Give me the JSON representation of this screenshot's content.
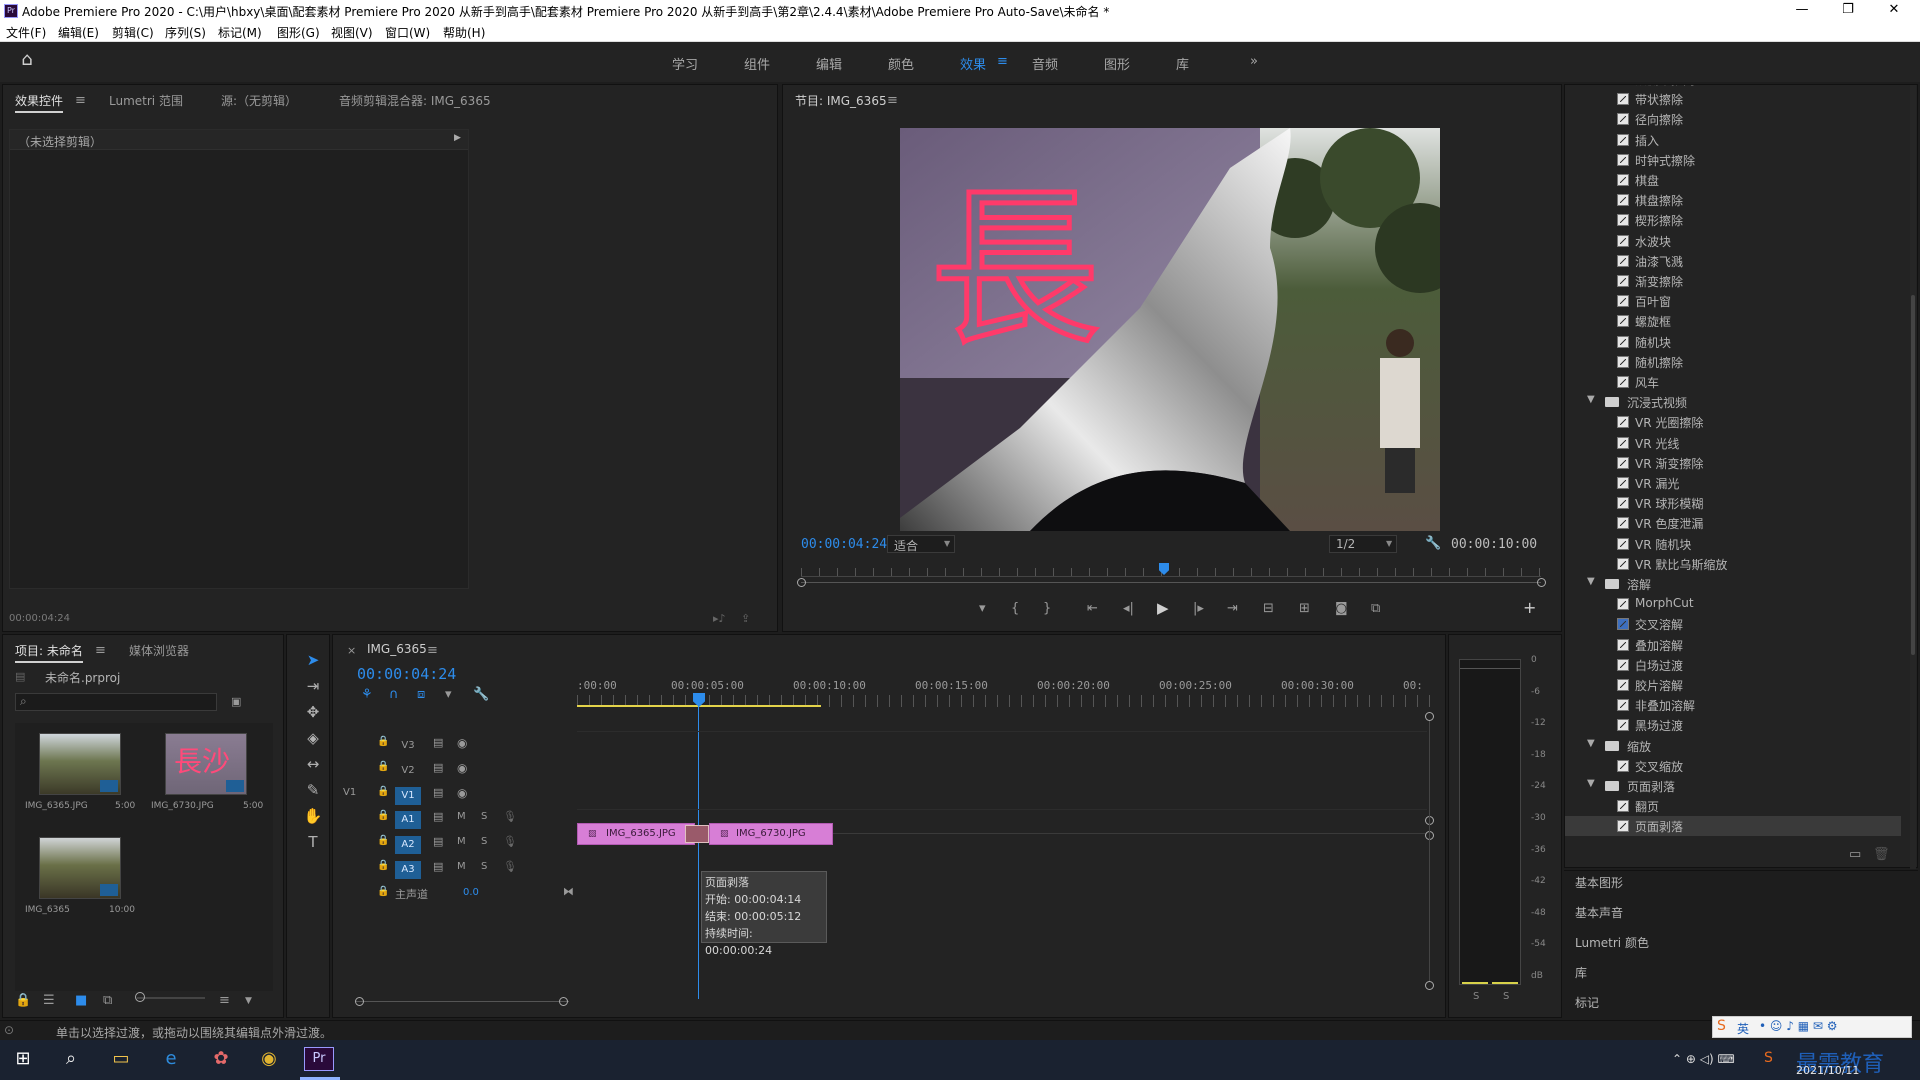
{
  "window": {
    "title": "Adobe Premiere Pro 2020 - C:\\用户\\hbxy\\桌面\\配套素材 Premiere Pro 2020 从新手到高手\\配套素材 Premiere Pro 2020 从新手到高手\\第2章\\2.4.4\\素材\\Adobe Premiere Pro Auto-Save\\未命名 *",
    "app_icon": "Pr",
    "minimize": "—",
    "restore": "❐",
    "close": "✕"
  },
  "menu": [
    "文件(F)",
    "编辑(E)",
    "剪辑(C)",
    "序列(S)",
    "标记(M)",
    "图形(G)",
    "视图(V)",
    "窗口(W)",
    "帮助(H)"
  ],
  "workspaces": {
    "tabs": [
      "学习",
      "组件",
      "编辑",
      "颜色",
      "效果",
      "音频",
      "图形",
      "库"
    ],
    "active": "效果",
    "more": "»"
  },
  "effect_controls": {
    "tabs": [
      "效果控件",
      "Lumetri 范围",
      "源:（无剪辑）",
      "音频剪辑混合器: IMG_6365"
    ],
    "no_clip": "（未选择剪辑）",
    "timecode": "00:00:04:24"
  },
  "program_monitor": {
    "title": "节目: IMG_6365",
    "current_time": "00:00:04:24",
    "fit": "适合",
    "resolution": "1/2",
    "duration": "00:00:10:00",
    "neon_text": "長"
  },
  "effects_tree": [
    {
      "type": "item",
      "label": "双侧平推门"
    },
    {
      "type": "item",
      "label": "带状擦除"
    },
    {
      "type": "item",
      "label": "径向擦除"
    },
    {
      "type": "item",
      "label": "插入"
    },
    {
      "type": "item",
      "label": "时钟式擦除"
    },
    {
      "type": "item",
      "label": "棋盘"
    },
    {
      "type": "item",
      "label": "棋盘擦除"
    },
    {
      "type": "item",
      "label": "楔形擦除"
    },
    {
      "type": "item",
      "label": "水波块"
    },
    {
      "type": "item",
      "label": "油漆飞溅"
    },
    {
      "type": "item",
      "label": "渐变擦除"
    },
    {
      "type": "item",
      "label": "百叶窗"
    },
    {
      "type": "item",
      "label": "螺旋框"
    },
    {
      "type": "item",
      "label": "随机块"
    },
    {
      "type": "item",
      "label": "随机擦除"
    },
    {
      "type": "item",
      "label": "风车"
    },
    {
      "type": "folder",
      "label": "沉浸式视频"
    },
    {
      "type": "item",
      "label": "VR 光圈擦除"
    },
    {
      "type": "item",
      "label": "VR 光线"
    },
    {
      "type": "item",
      "label": "VR 渐变擦除"
    },
    {
      "type": "item",
      "label": "VR 漏光"
    },
    {
      "type": "item",
      "label": "VR 球形模糊"
    },
    {
      "type": "item",
      "label": "VR 色度泄漏"
    },
    {
      "type": "item",
      "label": "VR 随机块"
    },
    {
      "type": "item",
      "label": "VR 默比乌斯缩放"
    },
    {
      "type": "folder",
      "label": "溶解"
    },
    {
      "type": "item",
      "label": "MorphCut"
    },
    {
      "type": "item",
      "label": "交叉溶解",
      "highlight": true
    },
    {
      "type": "item",
      "label": "叠加溶解"
    },
    {
      "type": "item",
      "label": "白场过渡"
    },
    {
      "type": "item",
      "label": "胶片溶解"
    },
    {
      "type": "item",
      "label": "非叠加溶解"
    },
    {
      "type": "item",
      "label": "黑场过渡"
    },
    {
      "type": "folder",
      "label": "缩放"
    },
    {
      "type": "item",
      "label": "交叉缩放"
    },
    {
      "type": "folder",
      "label": "页面剥落"
    },
    {
      "type": "item",
      "label": "翻页"
    },
    {
      "type": "item",
      "label": "页面剥落",
      "selected": true
    }
  ],
  "side_sections": [
    "基本图形",
    "基本声音",
    "Lumetri 颜色",
    "库",
    "标记"
  ],
  "project": {
    "tabs": [
      "项目: 未命名",
      "媒体浏览器"
    ],
    "file": "未命名.prproj",
    "items": [
      {
        "name": "IMG_6365.JPG",
        "duration": "5:00"
      },
      {
        "name": "IMG_6730.JPG",
        "duration": "5:00"
      },
      {
        "name": "IMG_6365",
        "duration": "10:00"
      }
    ]
  },
  "timeline": {
    "tab": "IMG_6365",
    "timecode": "00:00:04:24",
    "ruler": [
      ":00:00",
      "00:00:05:00",
      "00:00:10:00",
      "00:00:15:00",
      "00:00:20:00",
      "00:00:25:00",
      "00:00:30:00",
      "00:"
    ],
    "tracks": [
      {
        "id": "V3",
        "src": ""
      },
      {
        "id": "V2",
        "src": ""
      },
      {
        "id": "V1",
        "src": "V1"
      },
      {
        "id": "A1",
        "src": ""
      },
      {
        "id": "A2",
        "src": ""
      },
      {
        "id": "A3",
        "src": ""
      }
    ],
    "master_label": "主声道",
    "master_value": "0.0",
    "clips": [
      "IMG_6365.JPG",
      "IMG_6730.JPG"
    ],
    "track_m": "M",
    "track_s": "S",
    "tooltip": {
      "title": "页面剥落",
      "start": "开始: 00:00:04:14",
      "end": "结束: 00:00:05:12",
      "duration": "持续时间: 00:00:00:24"
    }
  },
  "audio_meter": {
    "scale": [
      "0",
      "-6",
      "-12",
      "-18",
      "-24",
      "-30",
      "-36",
      "-42",
      "-48",
      "-54",
      "dB"
    ],
    "solo": [
      "S",
      "S"
    ]
  },
  "status_bar": "单击以选择过渡，或拖动以围绕其编辑点外滑过渡。",
  "taskbar": {
    "date": "2021/10/11",
    "watermark": "最需教育",
    "ime": "英"
  }
}
